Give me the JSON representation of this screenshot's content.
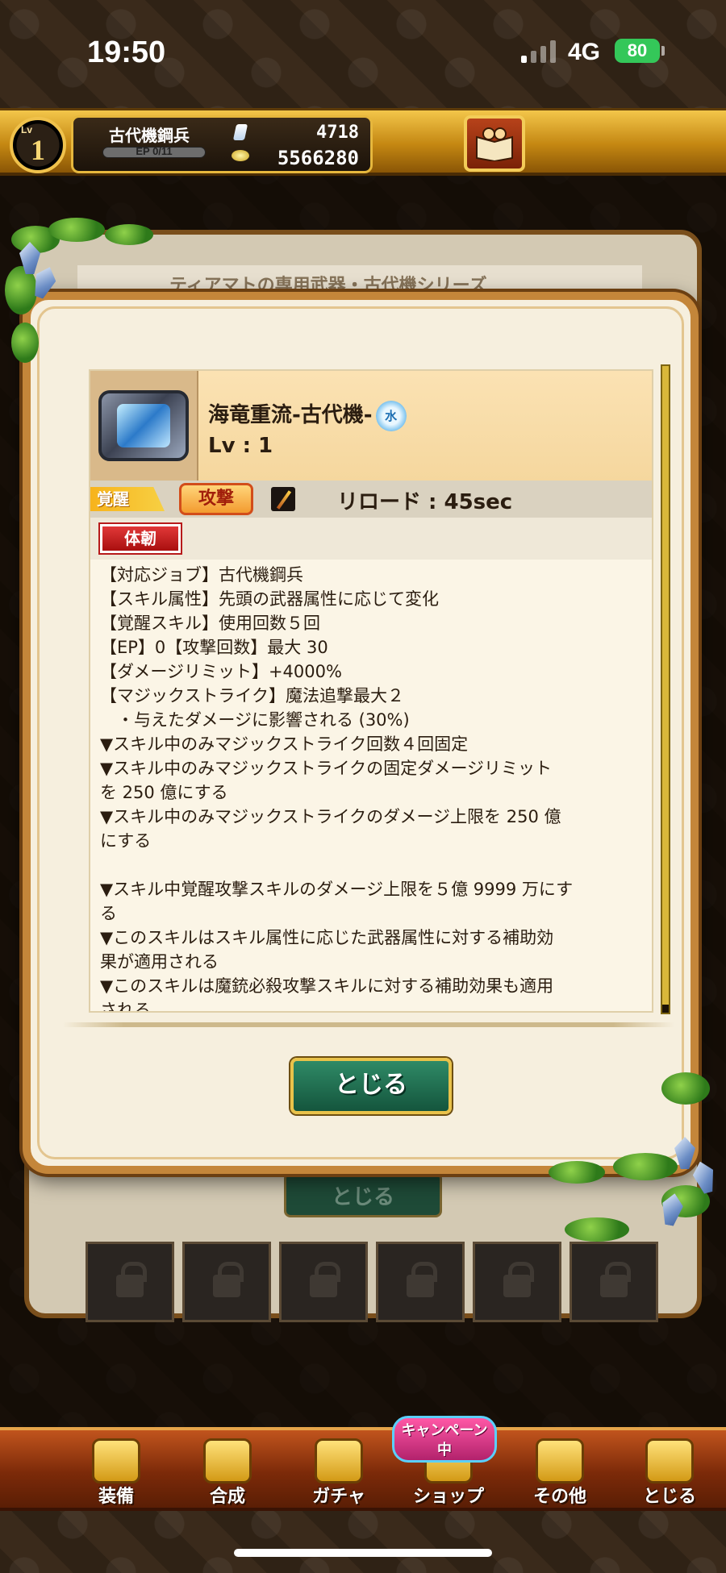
{
  "status_bar": {
    "time": "19:50",
    "network": "4G",
    "battery": "80"
  },
  "header": {
    "level_label": "Lv",
    "level": "1",
    "player_name": "古代機鋼兵",
    "ep_text": "EP 0/11",
    "gems": "4718",
    "gold": "5566280"
  },
  "background_panel": {
    "title": "ティアマトの専用武器・古代機シリーズ",
    "close_label": "とじる"
  },
  "skill": {
    "weapon_name": "海竜重流-古代機-",
    "element": "水",
    "level": "Lv : 1",
    "awaken_tag": "覚醒",
    "type_tag": "攻撃",
    "reload": "リロード : 45sec",
    "tough_tag": "体韌",
    "description": [
      "【対応ジョブ】古代機鋼兵",
      "【スキル属性】先頭の武器属性に応じて変化",
      "【覚醒スキル】使用回数５回",
      "【EP】0【攻撃回数】最大 30",
      "【ダメージリミット】+4000%",
      "【マジックストライク】魔法追撃最大２",
      "　・与えたダメージに影響される (30%)",
      "▼スキル中のみマジックストライク回数４回固定",
      "▼スキル中のみマジックストライクの固定ダメージリミット",
      "を 250 億にする",
      "▼スキル中のみマジックストライクのダメージ上限を 250 億",
      "にする",
      "",
      "▼スキル中覚醒攻撃スキルのダメージ上限を５億 9999 万にす",
      "る",
      "▼このスキルはスキル属性に応じた武器属性に対する補助効",
      "果が適用される",
      "▼このスキルは魔銃必殺攻撃スキルに対する補助効果も適用",
      "される"
    ]
  },
  "modal": {
    "close_label": "とじる"
  },
  "bottom_nav": {
    "equip": "装備",
    "synthesis": "合成",
    "gacha": "ガチャ",
    "shop": "ショップ",
    "other": "その他",
    "close": "とじる",
    "campaign_badge": "キャンペーン中"
  },
  "colors": {
    "accent_gold": "#e9c24a",
    "close_button_green": "#2f8a66",
    "tough_red": "#c41f1f",
    "panel_cream": "#f6efde"
  }
}
